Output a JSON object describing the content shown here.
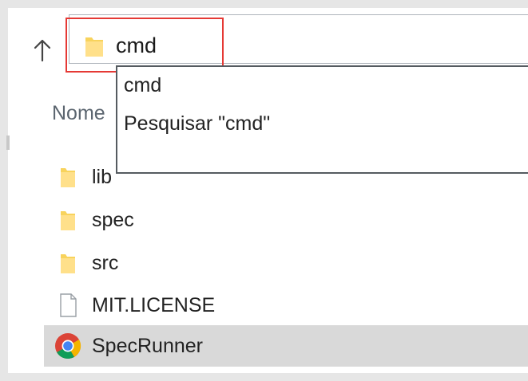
{
  "address_bar": {
    "value": "cmd",
    "folder_icon": "folder-icon",
    "up_icon": "up-arrow-icon"
  },
  "suggestions": [
    {
      "label": "cmd"
    },
    {
      "label": "Pesquisar \"cmd\""
    }
  ],
  "list": {
    "column_header": "Nome",
    "items": [
      {
        "name": "lib",
        "icon": "folder-icon"
      },
      {
        "name": "spec",
        "icon": "folder-icon"
      },
      {
        "name": "src",
        "icon": "folder-icon"
      },
      {
        "name": "MIT.LICENSE",
        "icon": "file-icon"
      },
      {
        "name": "SpecRunner",
        "icon": "chrome-icon"
      }
    ]
  },
  "colors": {
    "highlight": "#e53935",
    "folder": "#f8d35c",
    "selection": "#d9d9d9"
  }
}
